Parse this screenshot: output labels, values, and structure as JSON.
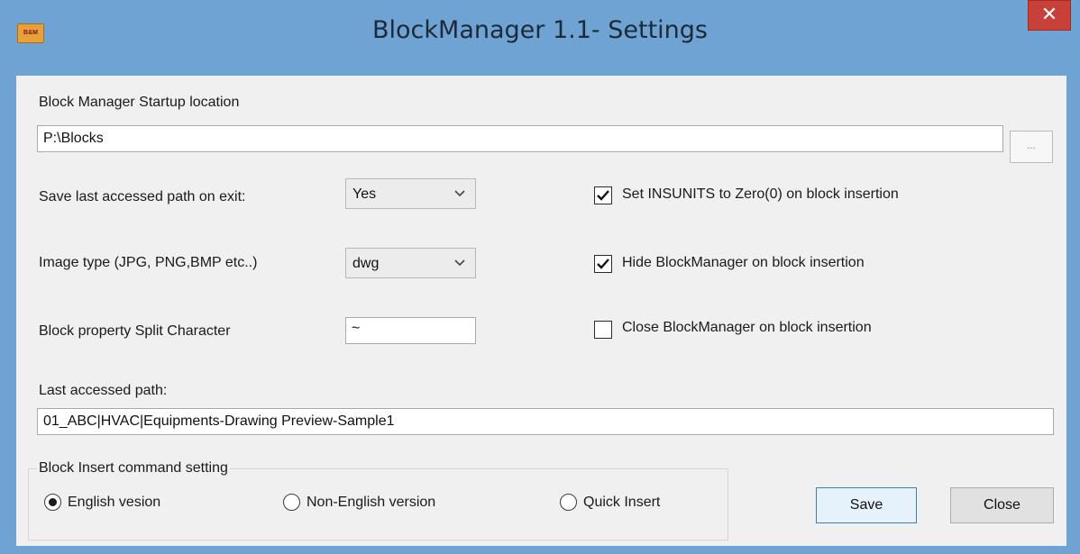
{
  "window": {
    "title": "BlockManager 1.1- Settings",
    "icon_text": "B&M",
    "close_glyph": "✕"
  },
  "startup": {
    "label": "Block Manager Startup location",
    "value": "P:\\Blocks",
    "browse_label": "..."
  },
  "save_path": {
    "label": "Save last accessed path on exit:",
    "value": "Yes"
  },
  "image_type": {
    "label": "Image type (JPG, PNG,BMP etc..)",
    "value": "dwg"
  },
  "split_char": {
    "label": "Block property Split Character",
    "value": "~"
  },
  "options": [
    {
      "label": "Set INSUNITS to Zero(0) on block insertion",
      "checked": true
    },
    {
      "label": "Hide BlockManager on block insertion",
      "checked": true
    },
    {
      "label": "Close BlockManager on block insertion",
      "checked": false
    }
  ],
  "last_path": {
    "label": "Last accessed path:",
    "value": "01_ABC|HVAC|Equipments-Drawing Preview-Sample1"
  },
  "insert_group": {
    "title": "Block Insert command setting",
    "radios": [
      {
        "label": "English vesion",
        "selected": true
      },
      {
        "label": "Non-English version",
        "selected": false
      },
      {
        "label": "Quick Insert",
        "selected": false
      }
    ]
  },
  "buttons": {
    "save": "Save",
    "close": "Close"
  }
}
